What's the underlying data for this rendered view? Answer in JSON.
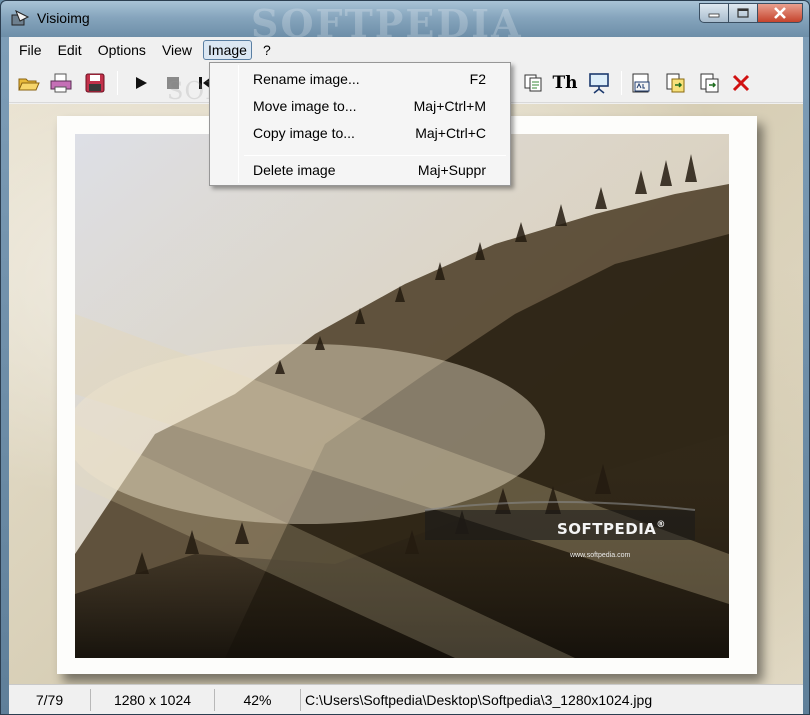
{
  "window": {
    "title": "Visioimg",
    "watermark": "SOFTPEDIA"
  },
  "menubar": {
    "items": [
      {
        "label": "File"
      },
      {
        "label": "Edit"
      },
      {
        "label": "Options"
      },
      {
        "label": "View"
      },
      {
        "label": "Image",
        "open": true
      },
      {
        "label": "?"
      }
    ]
  },
  "toolbar": {
    "thumbnails_label": "Th",
    "watermark": "SOFTPEDIA",
    "watermark_url": "www.softpedia.com"
  },
  "image_menu": {
    "items": [
      {
        "label": "Rename image...",
        "shortcut": "F2"
      },
      {
        "label": "Move image to...",
        "shortcut": "Maj+Ctrl+M"
      },
      {
        "label": "Copy image to...",
        "shortcut": "Maj+Ctrl+C"
      },
      {
        "label": "Delete image",
        "shortcut": "Maj+Suppr"
      }
    ]
  },
  "photo": {
    "logo_text": "SOFTPEDIA",
    "logo_mark": "®",
    "url_text": "www.softpedia.com"
  },
  "statusbar": {
    "index": "7/79",
    "dimensions": "1280 x 1024",
    "zoom": "42%",
    "path": "C:\\Users\\Softpedia\\Desktop\\Softpedia\\3_1280x1024.jpg"
  },
  "colors": {
    "close_accent": "#d11111",
    "titlebar": "#86a5bd"
  }
}
